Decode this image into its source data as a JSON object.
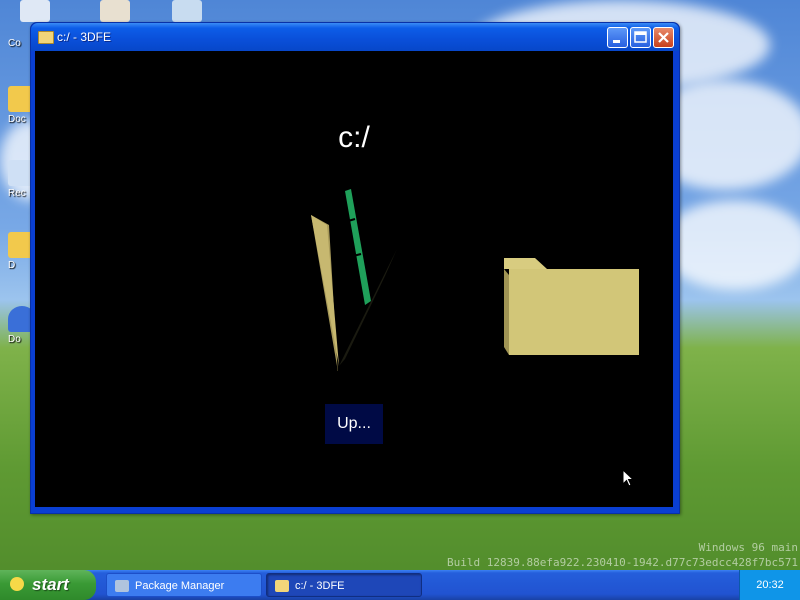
{
  "desktop": {
    "icons": [
      {
        "label": "Co",
        "color": "#dfe8f5"
      },
      {
        "label": "Doc",
        "color": "#f2c94c"
      },
      {
        "label": "Rec",
        "color": "#cfe0f5"
      },
      {
        "label": "D",
        "color": "#f2c94c"
      },
      {
        "label": "Do",
        "color": "#3a6fd8"
      }
    ],
    "build_line1": "Windows 96 main",
    "build_line2": "Build 12839.88efa922.230410-1942.d77c73edcc428f7bc571"
  },
  "window": {
    "title": "c:/ - 3DFE",
    "icon": "folder-icon",
    "controls": {
      "minimize": "minimize-icon",
      "maximize": "maximize-icon",
      "close": "close-icon"
    },
    "content": {
      "path": "c:/",
      "up_label": "Up...",
      "colors": {
        "folder": "#d2c678",
        "folder_side": "#a09454",
        "stripe": "#1fa05a",
        "background": "#000000",
        "up_button": "#000a45"
      }
    }
  },
  "taskbar": {
    "start_label": "start",
    "tasks": [
      {
        "label": "Package Manager",
        "icon": "package-manager-icon",
        "active": false
      },
      {
        "label": "c:/ - 3DFE",
        "icon": "folder-icon",
        "active": true
      }
    ],
    "clock": "20:32"
  }
}
